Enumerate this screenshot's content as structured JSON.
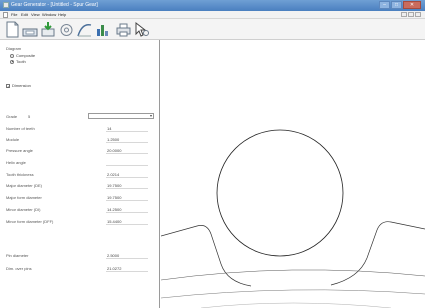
{
  "window": {
    "title": "Gear Generator - [Untitled - Spur Gear]",
    "minimize": "–",
    "maximize": "□",
    "close": "✕"
  },
  "menu": {
    "items": [
      "File",
      "Edit",
      "View",
      "Window",
      "Help"
    ]
  },
  "toolbar": {
    "buttons": [
      "new-document-icon",
      "save-icon",
      "export-icon",
      "gear-tool-icon",
      "curve-icon",
      "chart-icon",
      "print-icon",
      "cursor-icon"
    ]
  },
  "panel": {
    "diagram": {
      "title": "Diagram",
      "options": [
        {
          "label": "Composite",
          "selected": false
        },
        {
          "label": "Tooth",
          "selected": true
        }
      ]
    },
    "dimension": {
      "label": "Dimension",
      "checked": true
    },
    "grade": {
      "label": "Grade",
      "suffix": "5",
      "value": ""
    },
    "params": [
      {
        "label": "Number of teeth",
        "value": "14"
      },
      {
        "label": "Module",
        "value": "1.2500"
      },
      {
        "label": "Pressure angle",
        "value": "20.0000"
      },
      {
        "label": "Helix angle",
        "value": ""
      },
      {
        "label": "Tooth thickness",
        "value": "2.0214"
      },
      {
        "label": "Major diameter (DE)",
        "value": "19.7500"
      },
      {
        "label": "Major form diameter",
        "value": "19.7500"
      },
      {
        "label": "Minor diameter (DI)",
        "value": "14.2500"
      },
      {
        "label": "Minor form diameter (DFF)",
        "value": "15.4400"
      }
    ],
    "pin": [
      {
        "label": "Pin diameter",
        "value": "2.5000"
      },
      {
        "label": "Dim. over pins",
        "value": "21.0272"
      }
    ]
  },
  "colors": {
    "titlebar": "#4a7fbf",
    "drawing_line": "#222222",
    "panel_border": "#9a9a9a"
  }
}
